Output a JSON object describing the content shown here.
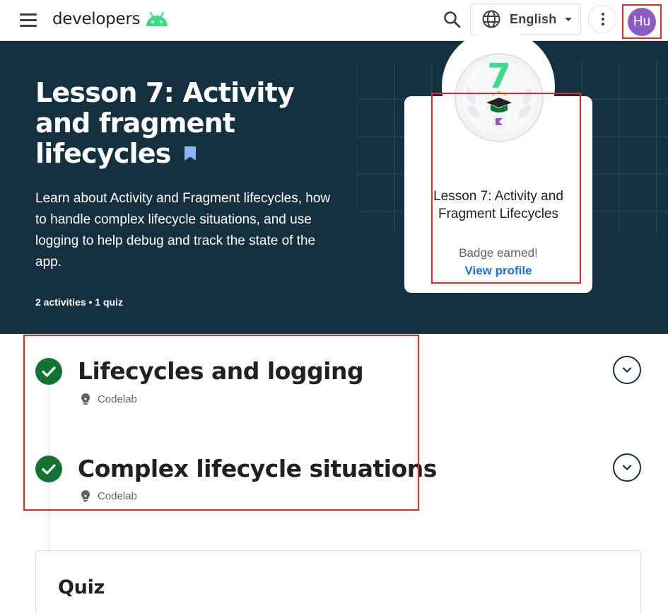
{
  "header": {
    "logo_text": "developers",
    "language": "English",
    "avatar_initials": "Hu"
  },
  "hero": {
    "title": "Lesson 7: Activity and fragment lifecycles",
    "description": "Learn about Activity and Fragment lifecycles, how to handle complex lifecycle situations, and use logging to help debug and track the state of the app.",
    "meta": "2 activities • 1 quiz"
  },
  "badge": {
    "number": "7",
    "title": "Lesson 7: Activity and Fragment Lifecycles",
    "status": "Badge earned!",
    "link_label": "View profile"
  },
  "activities": [
    {
      "title": "Lifecycles and logging",
      "type": "Codelab",
      "completed": true
    },
    {
      "title": "Complex lifecycle situations",
      "type": "Codelab",
      "completed": true
    }
  ],
  "quiz": {
    "title": "Quiz"
  },
  "colors": {
    "hero_bg": "#15303f",
    "android_green": "#3ddc84",
    "complete_green": "#137333",
    "link_blue": "#1a73e8",
    "avatar_purple": "#8a5cc4",
    "highlight_red": "#d93025"
  },
  "icons": [
    "menu-icon",
    "android-logo-icon",
    "search-icon",
    "globe-icon",
    "more-vert-icon",
    "bookmark-icon",
    "graduation-cap-icon",
    "check-icon",
    "lightbulb-icon",
    "chevron-down-icon"
  ]
}
